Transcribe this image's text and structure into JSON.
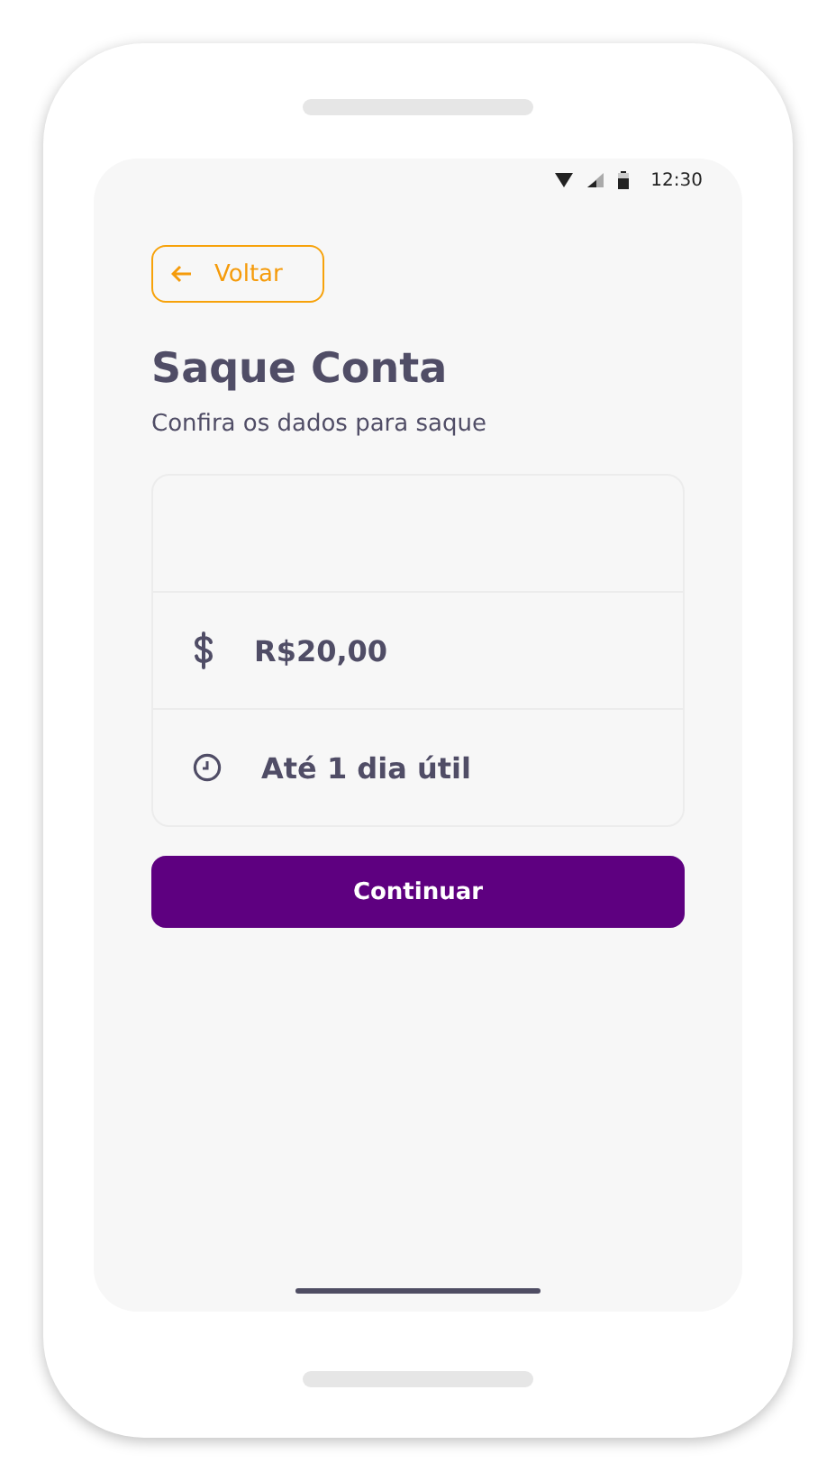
{
  "status_bar": {
    "time": "12:30"
  },
  "back_button": {
    "label": "Voltar"
  },
  "title": "Saque Conta",
  "subtitle": "Confira os dados para saque",
  "details": [
    {
      "kind": "empty"
    },
    {
      "kind": "amount",
      "text": "R$20,00"
    },
    {
      "kind": "time",
      "text": "Até 1 dia útil"
    }
  ],
  "continue_button": {
    "label": "Continuar"
  }
}
